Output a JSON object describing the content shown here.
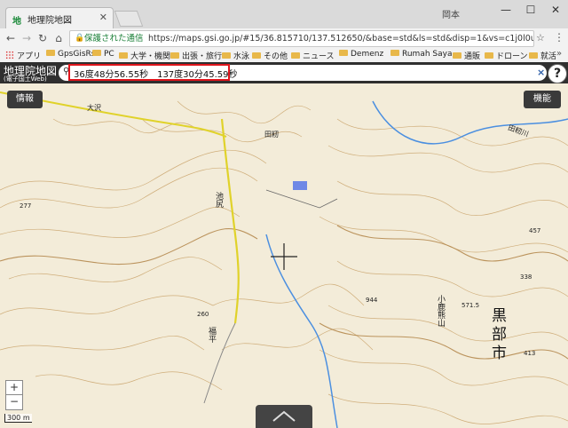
{
  "browser": {
    "tab_title": "地理院地図",
    "tab_favicon": "地",
    "user_name": "岡本",
    "secure_label": "保護された通信",
    "url": "https://maps.gsi.go.jp/#15/36.815710/137.512650/&base=std&ls=std&disp=1&vs=c1j0l0u0t0z0r0f0",
    "bookmarks": [
      "アプリ",
      "GpsGisRs",
      "PC",
      "大学・機関",
      "出張・旅行",
      "水泳",
      "その他",
      "ニュース",
      "Demenz",
      "Rumah Saya",
      "通販",
      "ドローン",
      "就活"
    ]
  },
  "gsi": {
    "logo_line1": "地理院地図",
    "logo_line2": "(電子国土Web)",
    "search_value": "36度48分56.55秒　137度30分45.59秒",
    "help_label": "?",
    "info_button": "情報",
    "function_button": "機能"
  },
  "map": {
    "zoom_in": "+",
    "zoom_out": "−",
    "scale_label": "300 m",
    "place_labels": {
      "osawa": "大沢",
      "tabara": "田籾",
      "ikejiri": "池尻",
      "fukuhira": "福平",
      "kurobe_city": "黒部市",
      "kokahumayama": "小鹿熊山",
      "tamogawa": "田籾川",
      "elev_1": "571.5",
      "elev_2": "260",
      "elev_3": "277",
      "elev_4": "413",
      "elev_5": "944",
      "elev_6": "457",
      "elev_7": "338"
    }
  },
  "colors": {
    "red_highlight": "#e0141b",
    "map_bg": "#f3ecd9",
    "contour": "#c9a36a",
    "river": "#4b8fe0",
    "road_yellow": "#e0d22a"
  }
}
